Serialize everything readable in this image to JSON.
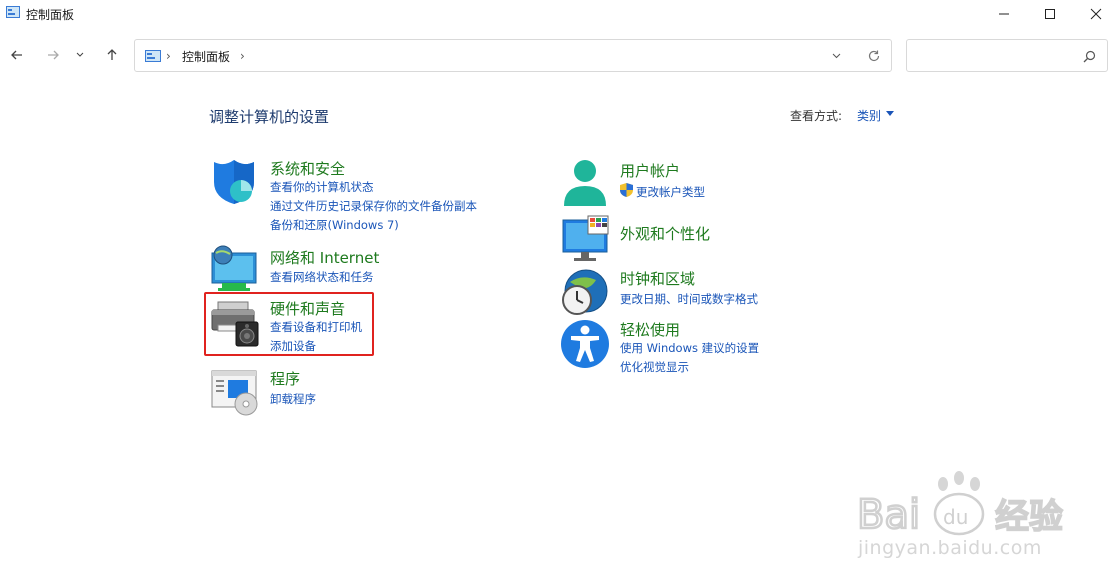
{
  "window": {
    "title": "控制面板"
  },
  "address": {
    "crumb": "控制面板",
    "sep": "›",
    "search_placeholder": ""
  },
  "main": {
    "page_title": "调整计算机的设置",
    "view_by_label": "查看方式:",
    "view_by_value": "类别"
  },
  "categories": {
    "system_security": {
      "title": "系统和安全",
      "links": [
        "查看你的计算机状态",
        "通过文件历史记录保存你的文件备份副本",
        "备份和还原(Windows 7)"
      ]
    },
    "network": {
      "title": "网络和 Internet",
      "links": [
        "查看网络状态和任务"
      ]
    },
    "hardware": {
      "title": "硬件和声音",
      "links": [
        "查看设备和打印机",
        "添加设备"
      ]
    },
    "programs": {
      "title": "程序",
      "links": [
        "卸载程序"
      ]
    },
    "user_accounts": {
      "title": "用户帐户",
      "links": [
        "更改帐户类型"
      ]
    },
    "appearance": {
      "title": "外观和个性化",
      "links": []
    },
    "clock_region": {
      "title": "时钟和区域",
      "links": [
        "更改日期、时间或数字格式"
      ]
    },
    "ease_of_access": {
      "title": "轻松使用",
      "links": [
        "使用 Windows 建议的设置",
        "优化视觉显示"
      ]
    }
  },
  "watermark": {
    "text": "jingyan.baidu.com",
    "logo_text": "Bai du 经验"
  },
  "colors": {
    "link": "#1a55b8",
    "category_title": "#1e7a1e",
    "highlight": "#e0231f"
  }
}
